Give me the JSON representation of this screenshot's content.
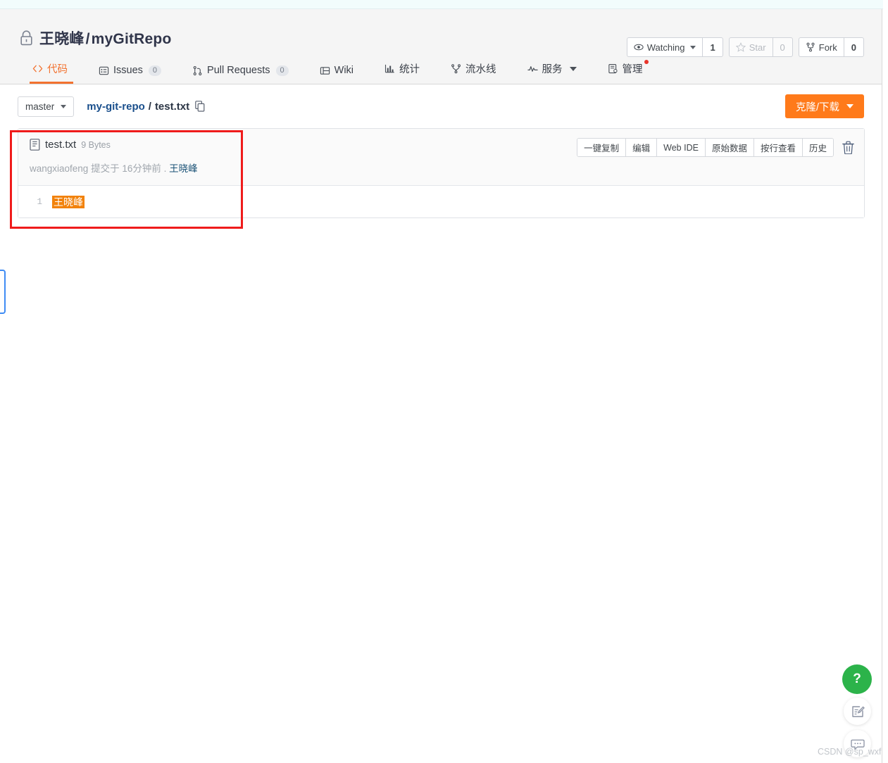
{
  "repo": {
    "owner": "王晓峰",
    "separator": "/",
    "name": "myGitRepo",
    "lock_icon": "lock-icon"
  },
  "header_actions": {
    "watching": {
      "icon": "eye-icon",
      "label": "Watching",
      "count": "1"
    },
    "star": {
      "icon": "star-icon",
      "label": "Star",
      "count": "0"
    },
    "fork": {
      "icon": "fork-icon",
      "label": "Fork",
      "count": "0"
    }
  },
  "nav": {
    "tabs": [
      {
        "icon": "code-icon",
        "label": "代码",
        "count": null,
        "active": true,
        "dropdown": false,
        "dot": false
      },
      {
        "icon": "issue-icon",
        "label": "Issues",
        "count": "0",
        "active": false,
        "dropdown": false,
        "dot": false
      },
      {
        "icon": "pull-request-icon",
        "label": "Pull Requests",
        "count": "0",
        "active": false,
        "dropdown": false,
        "dot": false
      },
      {
        "icon": "wiki-icon",
        "label": "Wiki",
        "count": null,
        "active": false,
        "dropdown": false,
        "dot": false
      },
      {
        "icon": "stats-icon",
        "label": "统计",
        "count": null,
        "active": false,
        "dropdown": false,
        "dot": false
      },
      {
        "icon": "pipeline-icon",
        "label": "流水线",
        "count": null,
        "active": false,
        "dropdown": false,
        "dot": false
      },
      {
        "icon": "service-icon",
        "label": "服务",
        "count": null,
        "active": false,
        "dropdown": true,
        "dot": false
      },
      {
        "icon": "manage-icon",
        "label": "管理",
        "count": null,
        "active": false,
        "dropdown": false,
        "dot": true
      }
    ]
  },
  "toolbar": {
    "branch": "master",
    "breadcrumb": {
      "repo": "my-git-repo",
      "separator": "/",
      "current": "test.txt",
      "copy_icon": "copy-icon"
    },
    "clone_button": "克隆/下载"
  },
  "file": {
    "icon": "file-text-icon",
    "name": "test.txt",
    "size": "9 Bytes",
    "commit_prefix": "wangxiaofeng 提交于 16分钟前 .",
    "commit_author": "王晓峰",
    "actions": [
      "一键复制",
      "编辑",
      "Web IDE",
      "原始数据",
      "按行查看",
      "历史"
    ],
    "delete_icon": "trash-icon",
    "lines": [
      {
        "number": "1",
        "text": "王晓峰"
      }
    ]
  },
  "floating": {
    "help_label": "?",
    "help_icon": "question-mark-icon",
    "feedback_icon": "feedback-edit-icon",
    "chat_icon": "chat-bubble-icon"
  },
  "watermark": "CSDN @sp_wxf",
  "colors": {
    "accent_orange": "#f27230",
    "clone_orange": "#ff7a1a",
    "highlight_orange": "#f2820b",
    "annotation_red": "#ef1b1b",
    "link_blue": "#1a4f8c",
    "help_green": "#2cb34a",
    "notification_red": "#e8342a"
  }
}
